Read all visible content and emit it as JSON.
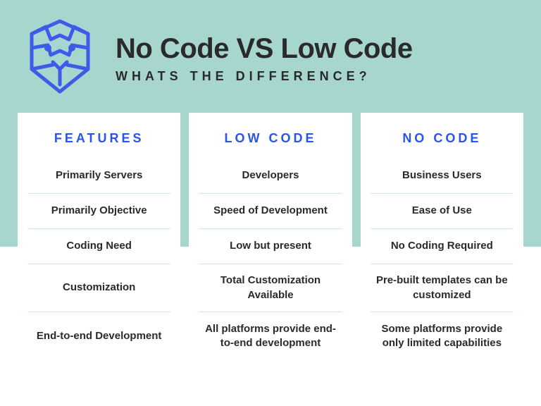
{
  "header": {
    "title": "No Code VS Low Code",
    "subtitle": "WHATS THE DIFFERENCE?"
  },
  "columns": [
    {
      "header": "FEATURES",
      "rows": [
        "Primarily Servers",
        "Primarily Objective",
        "Coding Need",
        "Customization",
        "End-to-end Development"
      ]
    },
    {
      "header": "LOW CODE",
      "rows": [
        "Developers",
        "Speed of Development",
        "Low but present",
        "Total Customization Available",
        "All platforms provide end-to-end development"
      ]
    },
    {
      "header": "NO CODE",
      "rows": [
        "Business Users",
        "Ease of Use",
        "No Coding Required",
        "Pre-built templates can be customized",
        "Some platforms provide only limited capabilities"
      ]
    }
  ]
}
